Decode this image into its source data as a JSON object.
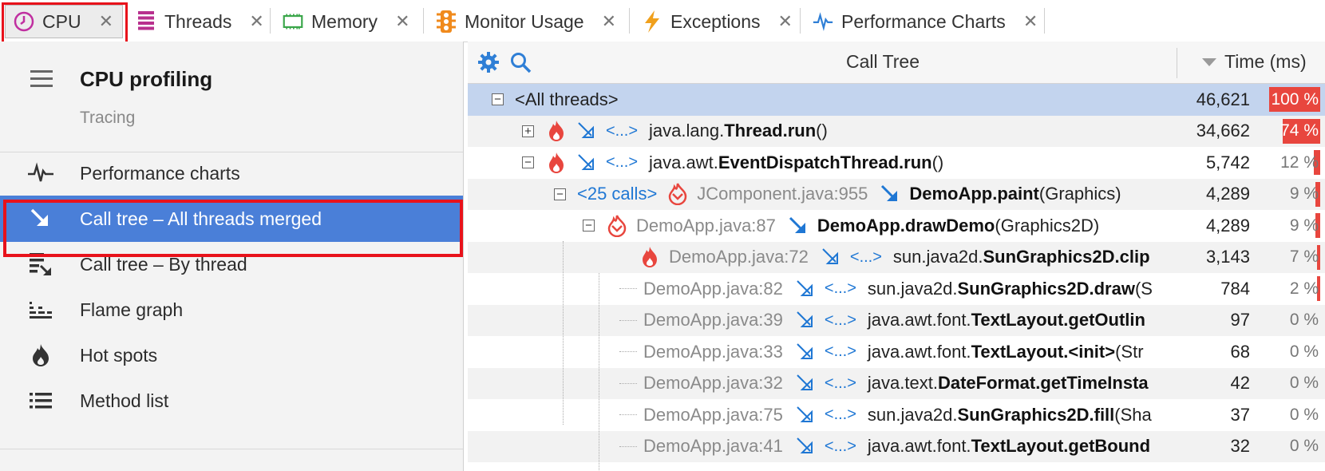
{
  "tabs": [
    {
      "label": "CPU",
      "icon": "clock-icon",
      "close": "✕"
    },
    {
      "label": "Threads",
      "icon": "threads-stack-icon",
      "close": "✕"
    },
    {
      "label": "Memory",
      "icon": "memory-chip-icon",
      "close": "✕"
    },
    {
      "label": "Monitor Usage",
      "icon": "traffic-light-icon",
      "close": "✕"
    },
    {
      "label": "Exceptions",
      "icon": "lightning-icon",
      "close": "✕"
    },
    {
      "label": "Performance Charts",
      "icon": "pulse-icon",
      "close": "✕"
    }
  ],
  "sidebar": {
    "title": "CPU profiling",
    "subtitle": "Tracing",
    "items": [
      {
        "label": "Performance charts",
        "icon": "pulse-icon"
      },
      {
        "label": "Call tree – All threads merged",
        "icon": "arrow-down-right-icon"
      },
      {
        "label": "Call tree – By thread",
        "icon": "call-tree-thread-icon"
      },
      {
        "label": "Flame graph",
        "icon": "flame-graph-icon"
      },
      {
        "label": "Hot spots",
        "icon": "hotspot-flame-icon"
      },
      {
        "label": "Method list",
        "icon": "list-icon"
      }
    ]
  },
  "main": {
    "header": {
      "call_tree": "Call Tree",
      "time": "Time (ms)"
    },
    "rows": [
      {
        "expander": "−",
        "label": "<All threads>",
        "time": "46,621",
        "pct": "100 %",
        "fraction": 1.0
      },
      {
        "expander": "+",
        "dots": "<...>",
        "pkg": "java.lang.",
        "cls": "Thread",
        "mth": ".run",
        "args": "()",
        "time": "34,662",
        "pct": "74 %",
        "fraction": 0.74
      },
      {
        "expander": "−",
        "dots": "<...>",
        "pkg": "java.awt.",
        "cls": "EventDispatchThread",
        "mth": ".run",
        "args": "()",
        "time": "5,742",
        "pct": "12 %",
        "fraction": 0.12
      },
      {
        "expander": "−",
        "calls": "<25 calls>",
        "src": "JComponent.java:955",
        "pkg": "",
        "cls": "DemoApp",
        "mth": ".paint",
        "args": "(Graphics)",
        "time": "4,289",
        "pct": "9 %",
        "fraction": 0.09
      },
      {
        "expander": "−",
        "src": "DemoApp.java:87",
        "pkg": "",
        "cls": "DemoApp",
        "mth": ".drawDemo",
        "args": "(Graphics2D)",
        "time": "4,289",
        "pct": "9 %",
        "fraction": 0.09
      },
      {
        "src": "DemoApp.java:72",
        "dots": "<...>",
        "pkg": "sun.java2d.",
        "cls": "SunGraphics2D",
        "mth": ".clip",
        "args": "",
        "time": "3,143",
        "pct": "7 %",
        "fraction": 0.07
      },
      {
        "src": "DemoApp.java:82",
        "dots": "<...>",
        "pkg": "sun.java2d.",
        "cls": "SunGraphics2D",
        "mth": ".draw",
        "args": "(S",
        "time": "784",
        "pct": "2 %",
        "fraction": 0.02
      },
      {
        "src": "DemoApp.java:39",
        "dots": "<...>",
        "pkg": "java.awt.font.",
        "cls": "TextLayout",
        "mth": ".getOutlin",
        "args": "",
        "time": "97",
        "pct": "0 %",
        "fraction": 0.0
      },
      {
        "src": "DemoApp.java:33",
        "dots": "<...>",
        "pkg": "java.awt.font.",
        "cls": "TextLayout",
        "mth": ".<init>",
        "args": "(Str",
        "time": "68",
        "pct": "0 %",
        "fraction": 0.0
      },
      {
        "src": "DemoApp.java:32",
        "dots": "<...>",
        "pkg": "java.text.",
        "cls": "DateFormat",
        "mth": ".getTimeInsta",
        "args": "",
        "time": "42",
        "pct": "0 %",
        "fraction": 0.0
      },
      {
        "src": "DemoApp.java:75",
        "dots": "<...>",
        "pkg": "sun.java2d.",
        "cls": "SunGraphics2D",
        "mth": ".fill",
        "args": "(Sha",
        "time": "37",
        "pct": "0 %",
        "fraction": 0.0
      },
      {
        "src": "DemoApp.java:41",
        "dots": "<...>",
        "pkg": "java.awt.font.",
        "cls": "TextLayout",
        "mth": ".getBound",
        "args": "",
        "time": "32",
        "pct": "0 %",
        "fraction": 0.0
      }
    ]
  },
  "colors": {
    "accent": "#4a7fd8",
    "highlight": "#e8121b",
    "bar": "#e8463e",
    "selected_row": "#c3d4ee"
  }
}
